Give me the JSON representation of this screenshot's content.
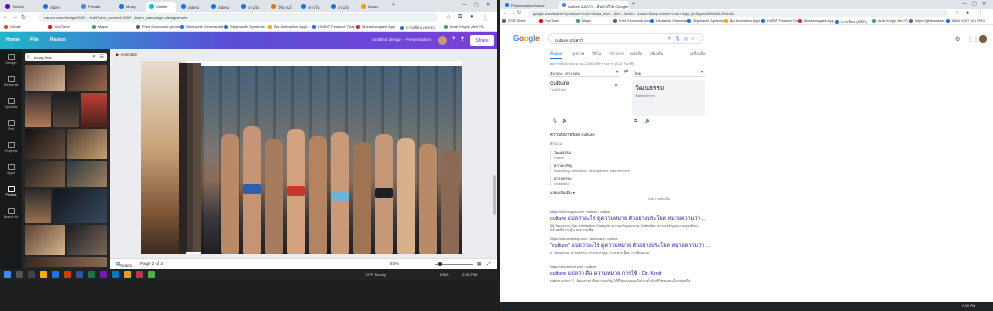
{
  "left_browser": {
    "tabs": [
      {
        "label": "Yahoo!",
        "color": "#6001d2"
      },
      {
        "label": "สมัคร",
        "color": "#1a73e8"
      },
      {
        "label": "Privatk",
        "color": "#4285f4"
      },
      {
        "label": "Muay",
        "color": "#1a73e8"
      },
      {
        "label": "Untitle",
        "color": "#00c4cc",
        "active": true
      },
      {
        "label": "สมัครเ",
        "color": "#1a73e8"
      },
      {
        "label": "สมัครเ",
        "color": "#1a73e8"
      },
      {
        "label": "งานใจ",
        "color": "#1a73e8"
      },
      {
        "label": "ใช้งานใ",
        "color": "#e37400"
      },
      {
        "label": "ข่าวใจ",
        "color": "#1a73e8"
      },
      {
        "label": "งานใจ",
        "color": "#1a73e8"
      },
      {
        "label": "Amaz",
        "color": "#ff9900"
      }
    ],
    "url": "canva.com/design/DAF... /edit?utm_content=DAF...&utm_campaign=designshare",
    "bookmarks": [
      {
        "label": "Gmail",
        "color": "#ea4335"
      },
      {
        "label": "YouTube",
        "color": "#ff0000"
      },
      {
        "label": "Maps",
        "color": "#34a853"
      },
      {
        "label": "Free Economic photo",
        "color": "#5f6368"
      },
      {
        "label": "Deutsche Grammatik",
        "color": "#1a73e8"
      },
      {
        "label": "Stephanie Symbole...",
        "color": "#1a73e8"
      },
      {
        "label": "Biz Animation Appl...",
        "color": "#f9ab00"
      },
      {
        "label": "HOBIT Finance Thai L...",
        "color": "#1a73e8"
      },
      {
        "label": "Mouseungaek App",
        "color": "#d93025"
      },
      {
        "label": "การเขียน (IEEE)",
        "color": "#1a73e8"
      },
      {
        "label": "Andi Krupp Jlen?S...",
        "color": "#34a853"
      }
    ],
    "canva_menu": [
      "Home",
      "File",
      "Resize"
    ],
    "canva_title": "Untitled design - Presentation",
    "share_label": "Share",
    "rail": [
      "Design",
      "Elements",
      "Uploads",
      "Text",
      "Projects",
      "Apps",
      "Photos",
      "Brand Kit"
    ],
    "active_rail": "Photos",
    "search_value": "muay thai",
    "animate_label": "Animate",
    "footer": {
      "notes": "Notes",
      "page": "Page 2 of 2",
      "zoom": "83%"
    },
    "taskbar": {
      "weather": "72°F Sunny",
      "time": "2:30 PM",
      "lang": "ENG"
    }
  },
  "right_browser": {
    "tabs": [
      {
        "label": "Photomotion/home",
        "color": "#1a73e8"
      },
      {
        "label": "culture แปลว่า - ค้นหาด้วย Google",
        "color": "#4285f4",
        "active": true
      }
    ],
    "url": "google.com/search?q=culture+แปลว่า&sca_esv=...&ei=...&ved=...&uact=5&oq=culture+แปลว่า&gs_lp=Egxnd3Mtd2l6LXNlcnAi",
    "bookmarks": [
      {
        "label": "ESR Grant",
        "color": "#5f6368"
      },
      {
        "label": "YouTube",
        "color": "#ff0000"
      },
      {
        "label": "Maps",
        "color": "#34a853"
      },
      {
        "label": "Free Economic photo",
        "color": "#5f6368"
      },
      {
        "label": "Deutsche Grammatik",
        "color": "#1a73e8"
      },
      {
        "label": "Stephanie Symbole...",
        "color": "#1a73e8"
      },
      {
        "label": "Biz Animation Appl...",
        "color": "#f9ab00"
      },
      {
        "label": "HOBIT Finance Thai L...",
        "color": "#1a73e8"
      },
      {
        "label": "Mouseungaek App",
        "color": "#d93025"
      },
      {
        "label": "การเขียน (IEEE)",
        "color": "#1a73e8"
      },
      {
        "label": "Andi Krupp Jlen?S...",
        "color": "#34a853"
      },
      {
        "label": "https://getbootstra...",
        "color": "#7952b3"
      },
      {
        "label": "8804 CSIT 101 PRO",
        "color": "#1a73e8"
      }
    ],
    "google_logo": "Google",
    "query": "culture แปลว่า",
    "filters": [
      "ทั้งหมด",
      "รูปภาพ",
      "วิดีโอ",
      "ข่าวสาร",
      "หนังสือ",
      "เพิ่มเติม"
    ],
    "tools": "เครื่องมือ",
    "stats": "ผลการค้นหาประมาณ 2,300,000 รายการ (0.37 วินาที)",
    "translate": {
      "source_lang": "อังกฤษ - ตรวจพบ",
      "target_lang": "ไทย",
      "source_text": "culture",
      "source_phonetic": "/ˈkəlCHər/",
      "target_text": "วัฒนธรรม",
      "target_phonetic": "Watthnṭhrrm"
    },
    "definitions": {
      "header": "ความหมายของ culture",
      "pos": "คำนาม",
      "rows": [
        {
          "term": "วัฒนธรรม",
          "gloss": "culture"
        },
        {
          "term": "ความเจริญ",
          "gloss": "flourishing, civilization, development, improvement"
        },
        {
          "term": "อารยธรรม",
          "gloss": "civilization"
        }
      ],
      "more": "แสดงเพิ่มเติม",
      "feedback": "ส่งความคิดเห็น"
    },
    "results": [
      {
        "source": "https://dict.longdo.com › search › culture",
        "title": "culture แปลว่าอะไร ดูความหมาย ตัวอย่างประโยค หมายความว่า ...",
        "snippet": "[N] วัฒนธรรม Syn. civilization, Example: ความเจริญงอกงาม, Definition: ความเจริญงอกงามของศิลปะ ประเพณีความรู้ และความเชื่อ"
      },
      {
        "source": "https://dict.meaning.com › dictionary › culture",
        "title": "\"culture\" แปลว่าอะไร ดูความหมาย ตัวอย่างประโยค หมายความว่า ...",
        "snippet": "n. วัฒนธรรม, อารยธรรม, การเพาะปลูก, การเพาะเลี้ยง, การฝึกอบรม"
      },
      {
        "source": "https://dict.drkrnit.com › culture",
        "title": "culture แปลว่า คือ ความหมาย การใช้ - Dr. Krnit",
        "snippet": "culture แปลว่า ?. วัฒนธรรม คือความเจริญ วิถีชีวิตแบบแผนในการดำเนินชีวิตของคนในกลุ่มหนึ่ง"
      }
    ],
    "taskbar": {
      "time": "2:30 PM"
    }
  }
}
